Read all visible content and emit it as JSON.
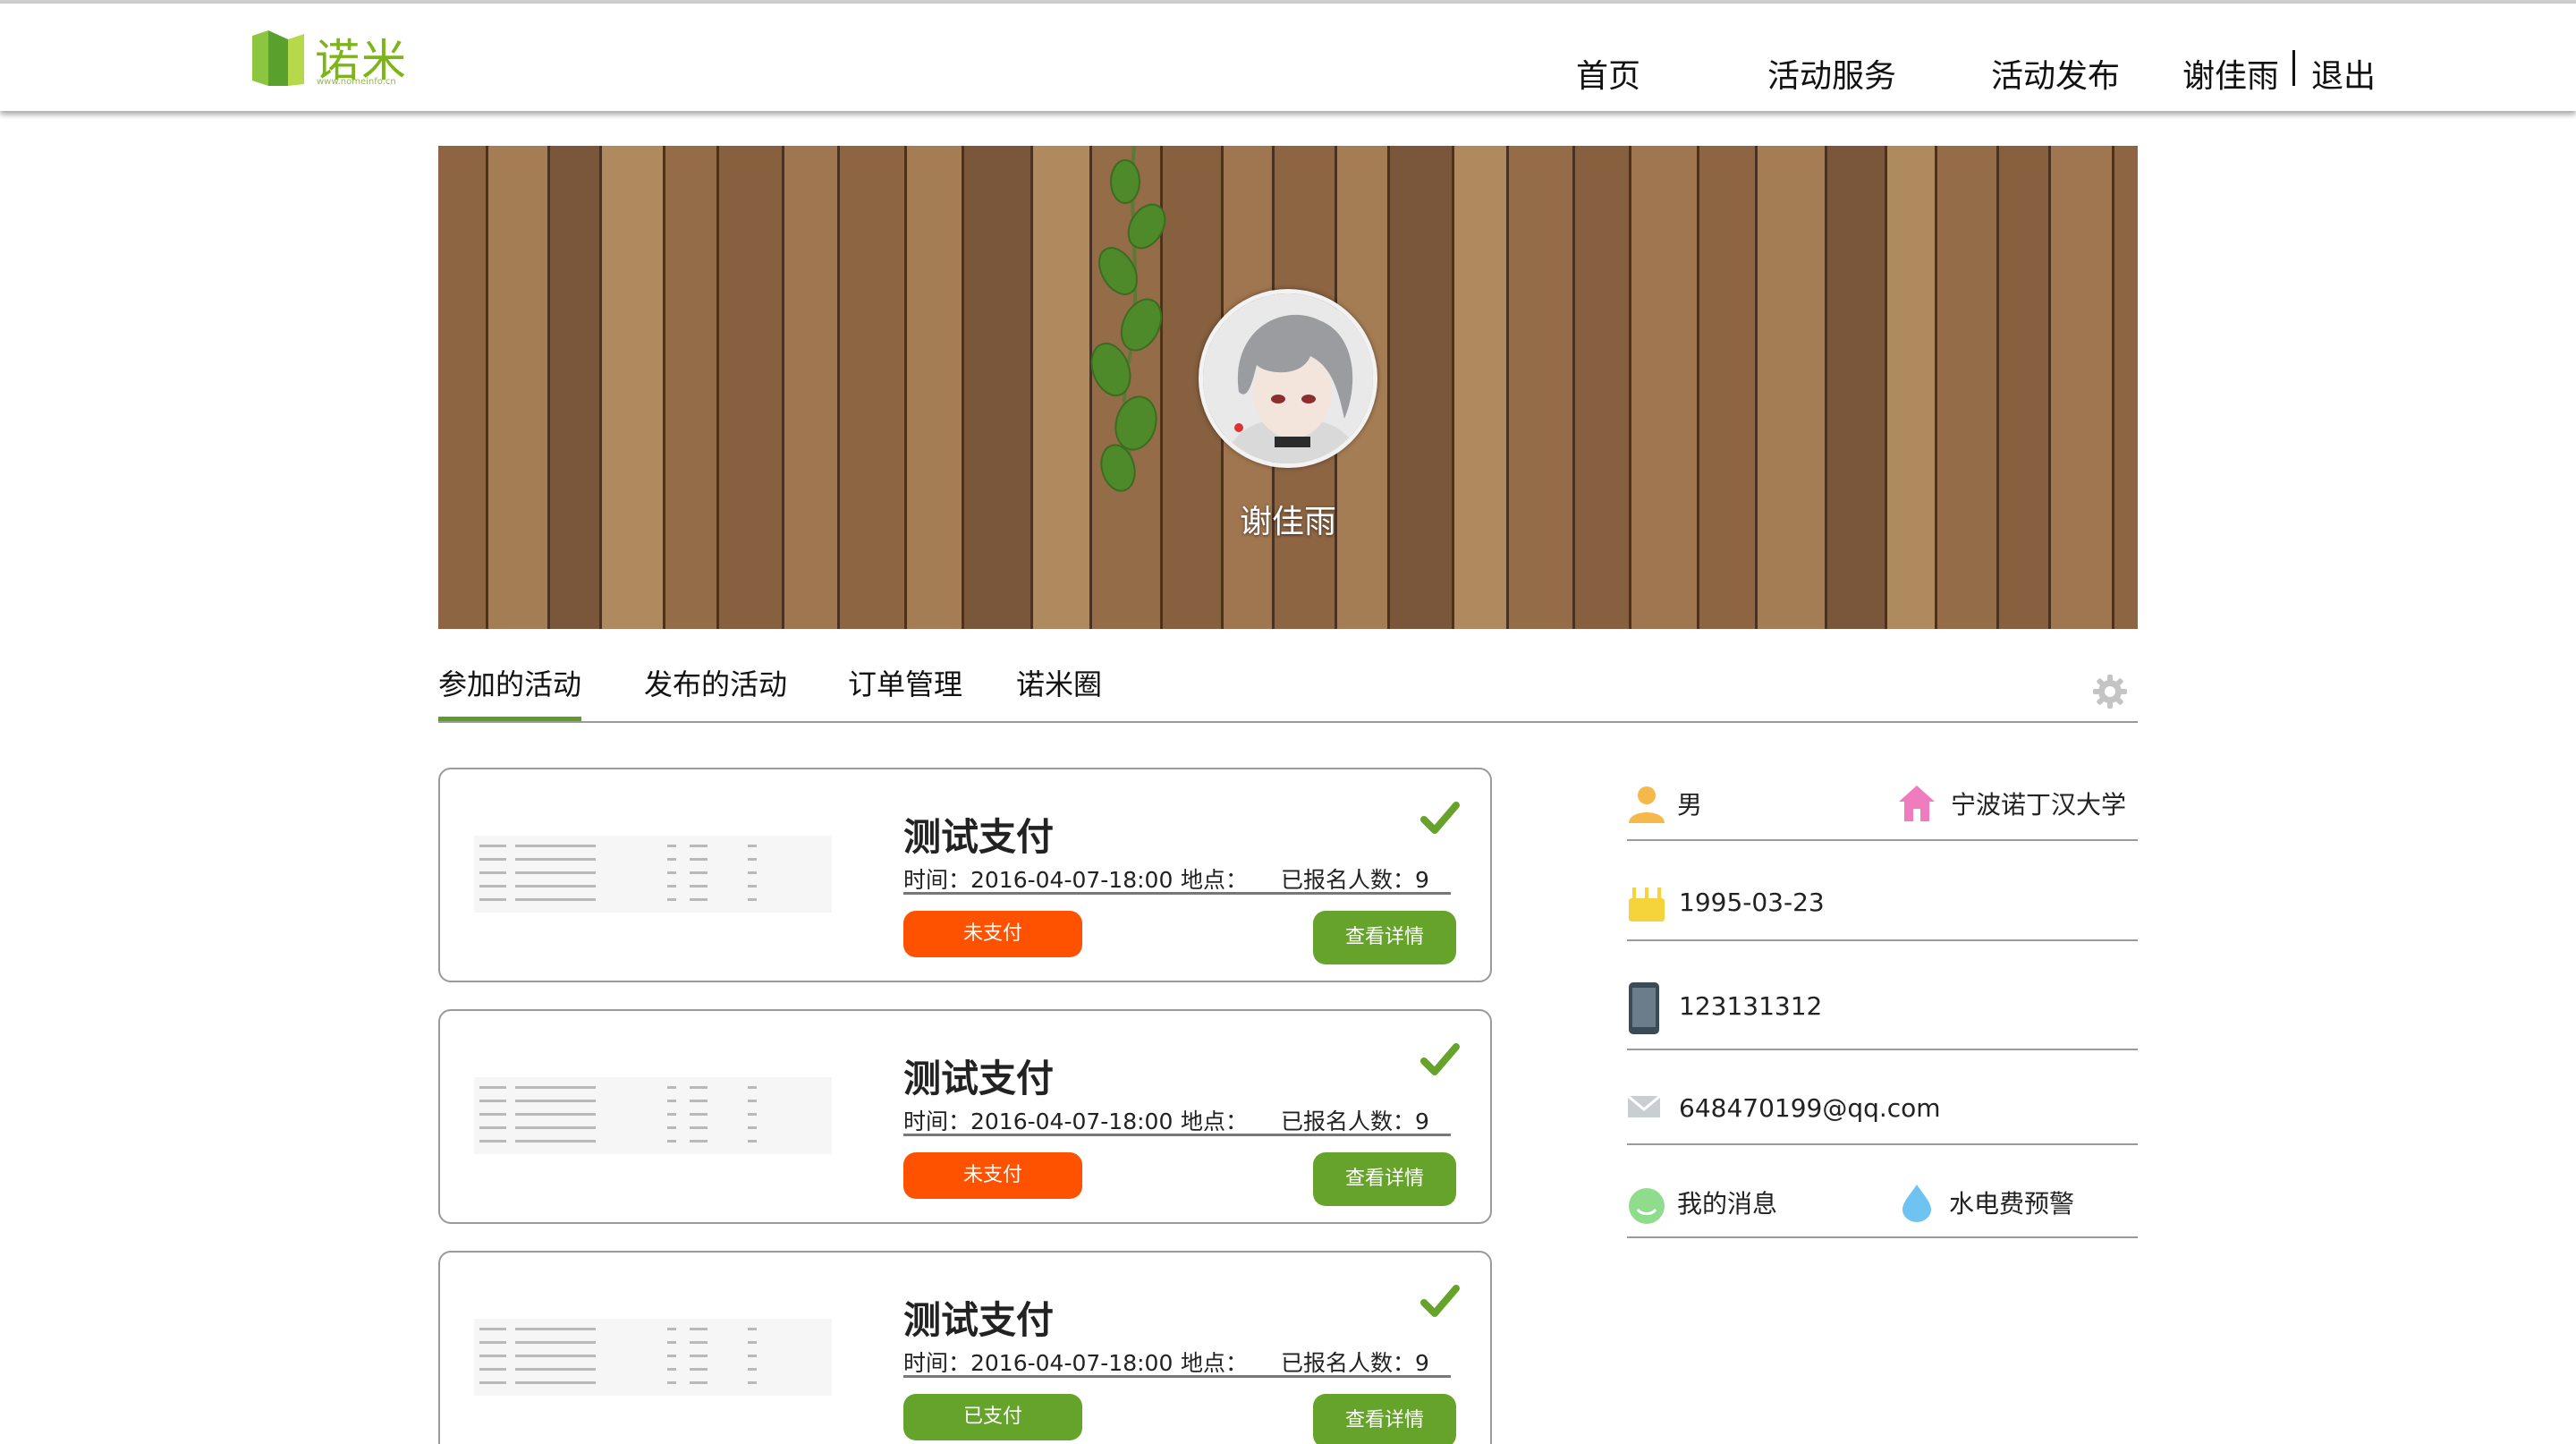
{
  "header": {
    "logo_text": "诺米",
    "logo_subtext": "www.nomeinfo.cn",
    "nav": [
      "首页",
      "活动服务",
      "活动发布"
    ],
    "user_name": "谢佳雨",
    "logout": "退出"
  },
  "banner": {
    "user_name": "谢佳雨"
  },
  "tabs": [
    "参加的活动",
    "发布的活动",
    "订单管理",
    "诺米圈"
  ],
  "activities": [
    {
      "title": "测试支付",
      "time": "时间：2016-04-07-18:00",
      "place": "地点：",
      "signed_up": "已报名人数：9",
      "pay_status": "未支付",
      "detail_label": "查看详情"
    },
    {
      "title": "测试支付",
      "time": "时间：2016-04-07-18:00",
      "place": "地点：",
      "signed_up": "已报名人数：9",
      "pay_status": "未支付",
      "detail_label": "查看详情"
    },
    {
      "title": "测试支付",
      "time": "时间：2016-04-07-18:00",
      "place": "地点：",
      "signed_up": "已报名人数：9",
      "pay_status": "已支付",
      "detail_label": "查看详情"
    }
  ],
  "profile": {
    "gender": "男",
    "school": "宁波诺丁汉大学",
    "birthday": "1995-03-23",
    "phone": "123131312",
    "email": "648470199@qq.com",
    "messages": "我的消息",
    "utility_alert": "水电费预警"
  },
  "colors": {
    "accent_green": "#66a32a",
    "unpaid_orange": "#ff5200",
    "tab_underline": "#5e9b2a"
  },
  "icons": [
    "logo-icon",
    "settings-gear-icon",
    "check-icon",
    "user-icon",
    "home-icon",
    "birthday-cake-icon",
    "phone-icon",
    "mail-icon",
    "message-icon",
    "water-drop-icon"
  ]
}
